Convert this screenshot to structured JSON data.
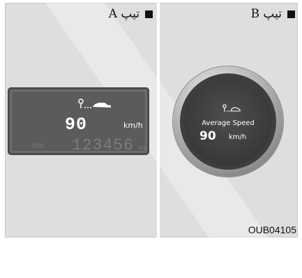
{
  "panels": [
    {
      "label": "تیپ A"
    },
    {
      "label": "تیپ B"
    }
  ],
  "lcd": {
    "speed": "90",
    "unit": "km/h",
    "odometer": "123456",
    "odometer_unit": "km",
    "odometer_prefix": "ooo",
    "icons": [
      "key-icon",
      "car-icon"
    ]
  },
  "gauge": {
    "title": "Average Speed",
    "speed": "90",
    "unit": "km/h",
    "icons": [
      "key-icon",
      "car-icon"
    ]
  },
  "figure_code": "OUB04105",
  "colors": {
    "lcd": "#5b5b5b",
    "gauge_face": "#363636",
    "text": "#ffffff"
  }
}
